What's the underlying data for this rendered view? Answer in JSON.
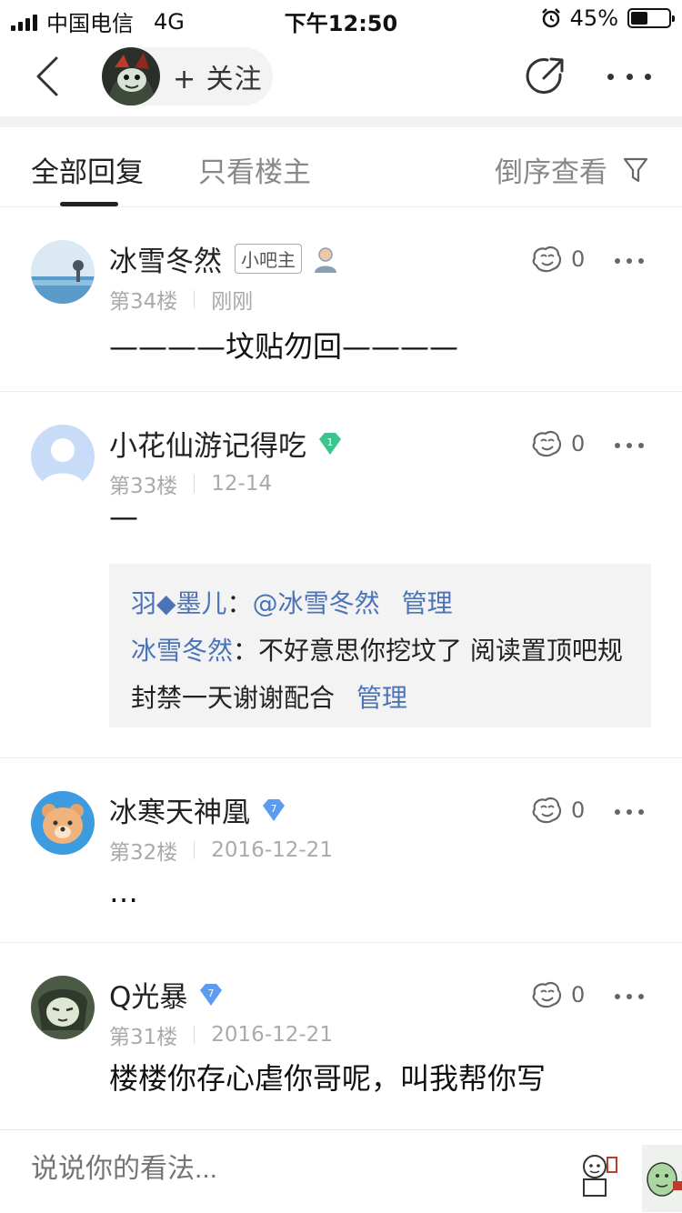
{
  "status_bar": {
    "carrier": "中国电信",
    "network": "4G",
    "time": "下午12:50",
    "battery_text": "45%",
    "battery_level": 0.45
  },
  "nav": {
    "follow_label": "+ 关注",
    "icons": {
      "back": "chevron-left-icon",
      "share": "share-icon",
      "more": "more-icon"
    }
  },
  "tabs": {
    "all_replies": "全部回复",
    "owner_only": "只看楼主",
    "sort_label": "倒序查看",
    "active": "all_replies"
  },
  "replies": [
    {
      "name": "冰雪冬然",
      "badge": "小吧主",
      "floor": "第34楼",
      "time": "刚刚",
      "likes": "0",
      "content": "————坟贴勿回————"
    },
    {
      "name": "小花仙游记得吃",
      "level": "1",
      "floor": "第33楼",
      "time": "12-14",
      "likes": "0",
      "content": "—",
      "sub_replies": [
        {
          "author": "羽◆墨儿",
          "sep": "：",
          "text": "@冰雪冬然",
          "action": "管理"
        },
        {
          "author": "冰雪冬然",
          "sep": "：",
          "text": "不好意思你挖坟了 阅读置顶吧规封禁一天谢谢配合",
          "action": "管理"
        }
      ]
    },
    {
      "name": "冰寒天神凰",
      "level": "7",
      "floor": "第32楼",
      "time": "2016-12-21",
      "likes": "0",
      "content": "…"
    },
    {
      "name": "Q光暴",
      "level": "7",
      "floor": "第31楼",
      "time": "2016-12-21",
      "likes": "0",
      "content": "楼楼你存心虐你哥呢，叫我帮你写"
    }
  ],
  "bottom_bar": {
    "placeholder": "说说你的看法..."
  },
  "colors": {
    "link": "#4a73b8",
    "level_green": "#3cc48f",
    "level_blue": "#5b9bf0"
  }
}
